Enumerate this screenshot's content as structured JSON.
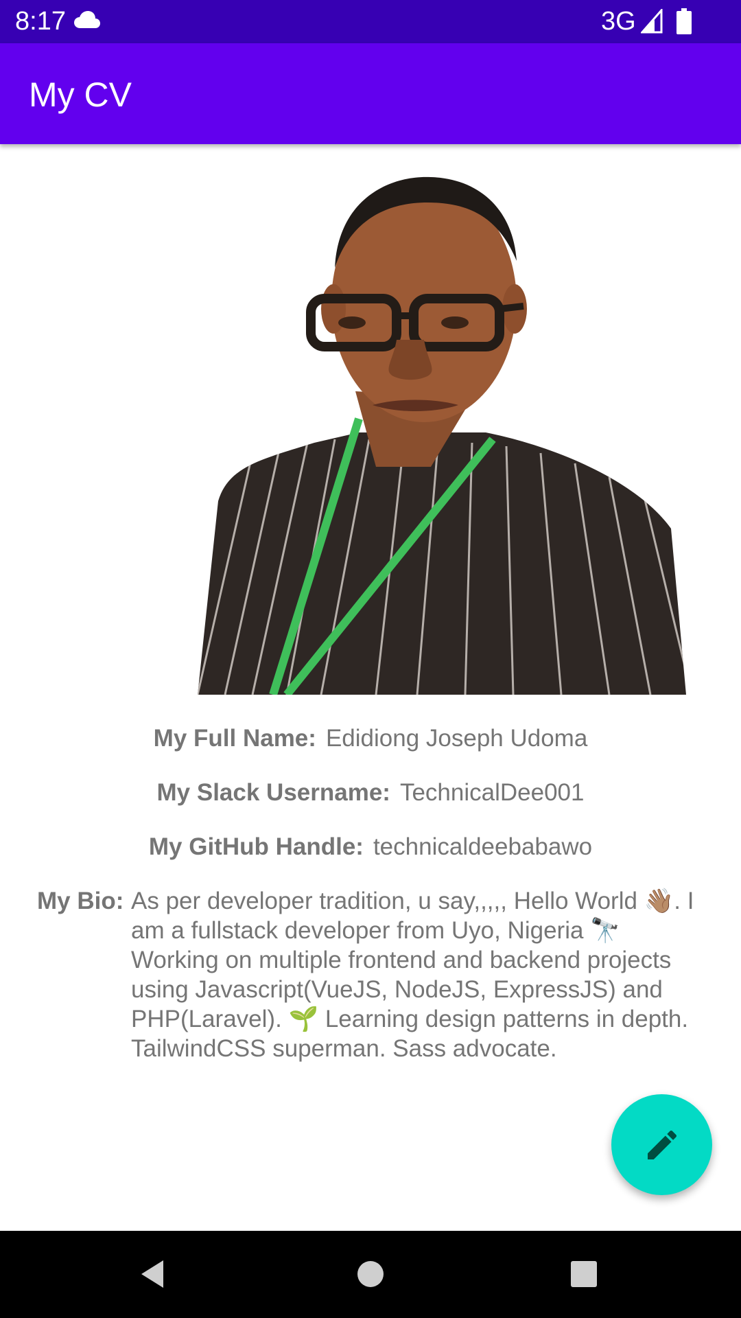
{
  "status_bar": {
    "time": "8:17",
    "network": "3G",
    "icons": [
      "cloud-icon",
      "signal-icon",
      "battery-icon"
    ]
  },
  "app_bar": {
    "title": "My CV"
  },
  "profile": {
    "photo_alt": "profile-photo",
    "full_name_label": "My Full Name:",
    "full_name": "Edidiong Joseph Udoma",
    "slack_label": "My Slack Username:",
    "slack_username": "TechnicalDee001",
    "github_label": "My GitHub Handle:",
    "github_handle": "technicaldeebabawo",
    "bio_label": "My Bio:",
    "bio": "As per developer tradition, u say,,,,, Hello World 👋🏽. I am a fullstack developer from Uyo, Nigeria 🔭 Working on multiple frontend and backend projects using Javascript(VueJS, NodeJS, ExpressJS) and PHP(Laravel). 🌱 Learning design patterns in depth. TailwindCSS superman. Sass advocate."
  },
  "fab": {
    "icon": "pencil-icon"
  },
  "nav_bar": {
    "icons": [
      "back-icon",
      "home-icon",
      "recents-icon"
    ]
  },
  "colors": {
    "status_bar": "#3700b3",
    "app_bar": "#6200ee",
    "fab": "#03dac5",
    "text": "#757575"
  }
}
